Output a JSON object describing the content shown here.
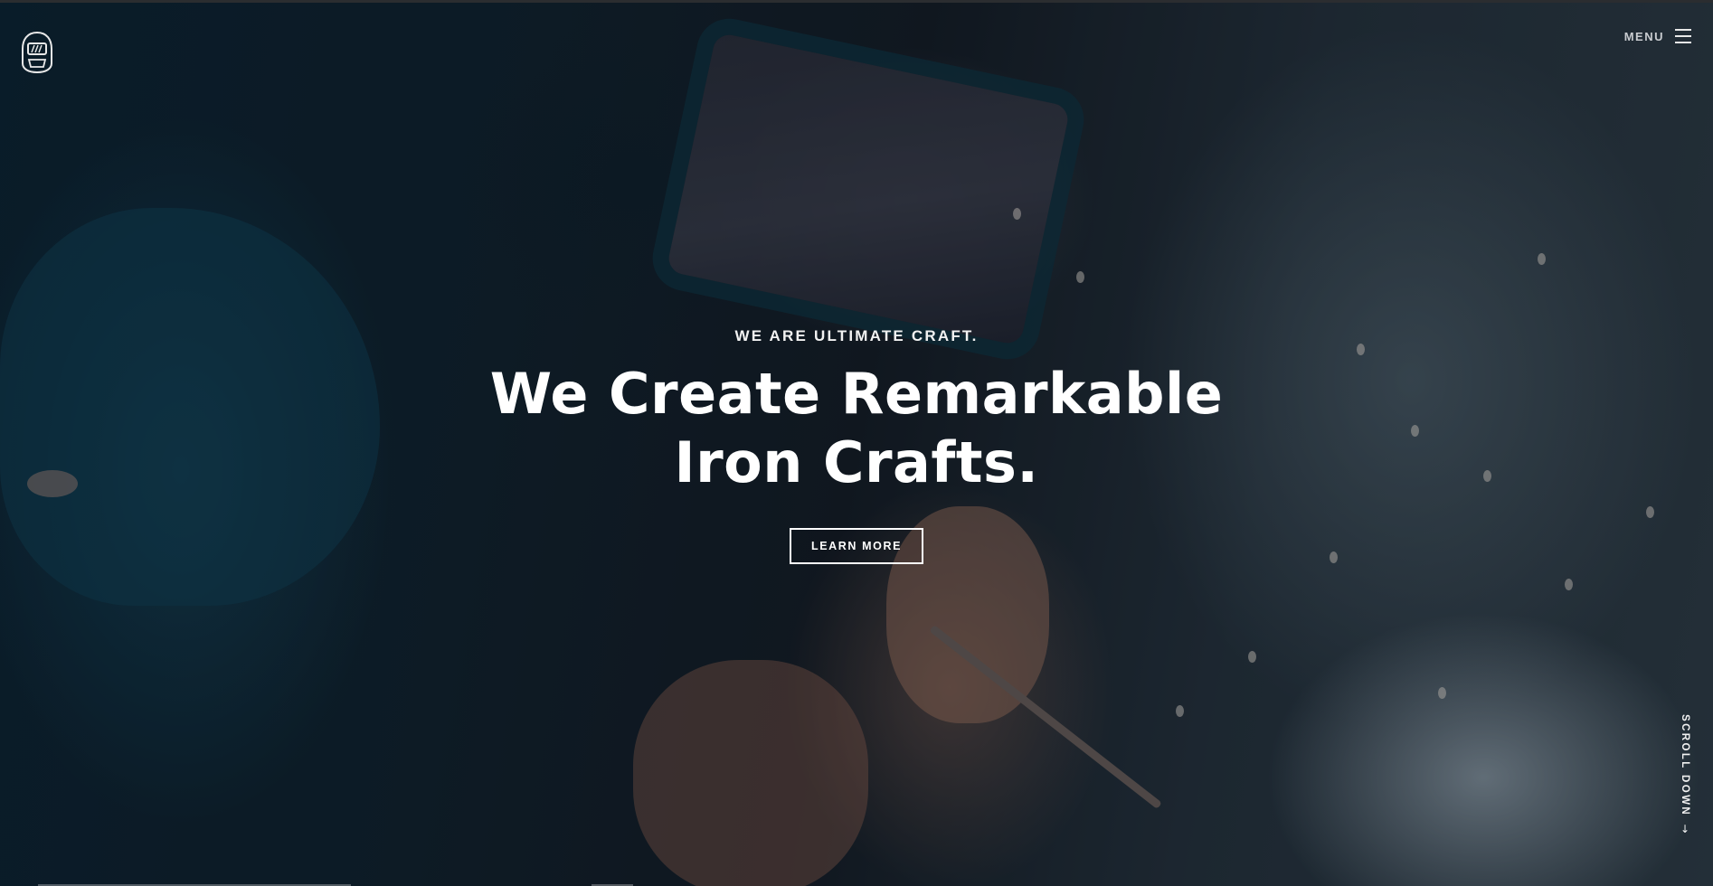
{
  "header": {
    "logo_icon": "welding-helmet-icon",
    "menu_label": "MENU",
    "menu_icon": "hamburger-menu-icon"
  },
  "hero": {
    "kicker": "WE ARE ULTIMATE CRAFT.",
    "headline_line1": "We Create Remarkable",
    "headline_line2": "Iron Crafts.",
    "cta_label": "LEARN MORE",
    "scroll_label": "SCROLL DOWN",
    "scroll_icon": "arrow-down-icon"
  },
  "colors": {
    "text": "#ffffff",
    "background": "#0f1820"
  }
}
